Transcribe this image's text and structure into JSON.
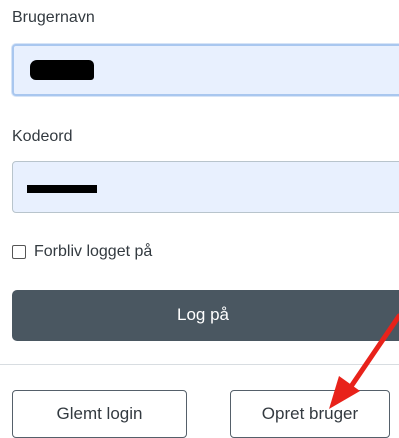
{
  "form": {
    "username_label": "Brugernavn",
    "password_label": "Kodeord",
    "remember_label": "Forbliv logget på",
    "remember_checked": false,
    "login_button": "Log på",
    "forgot_button": "Glemt login",
    "create_button": "Opret bruger"
  },
  "annotation": {
    "arrow_color": "#e8221a"
  },
  "colors": {
    "field_bg": "#e8f0fe",
    "login_button_bg": "#4a5761"
  }
}
